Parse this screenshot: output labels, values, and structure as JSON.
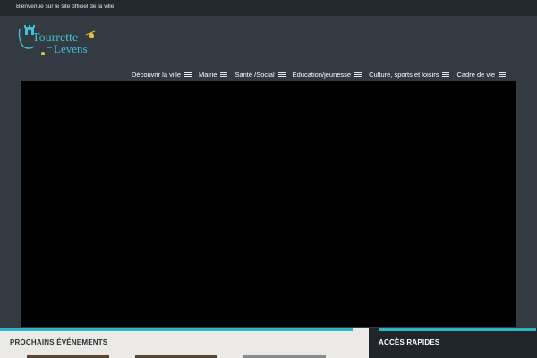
{
  "topbar": {
    "welcome": "Bienvenue sur le site officiel de la ville"
  },
  "logo": {
    "line1": "Tourrette",
    "line2": "Levens",
    "icon": "castle-crest-icon",
    "color": "#3fc1d6"
  },
  "nav": {
    "items": [
      {
        "label": "Découvrir la ville"
      },
      {
        "label": "Mairie"
      },
      {
        "label": "Santé /Social"
      },
      {
        "label": "Education/jeunesse"
      },
      {
        "label": "Culture, sports et loisirs"
      },
      {
        "label": "Cadre de vie"
      }
    ],
    "icon": "hamburger-menu-icon"
  },
  "sections": {
    "events_title": "PROCHAINS ÉVÉNEMENTS",
    "quick_access_title": "ACCÈS RAPIDES"
  },
  "colors": {
    "accent": "#2ab5c9",
    "header_bg": "#343a42",
    "topbar_bg": "#23282f"
  }
}
